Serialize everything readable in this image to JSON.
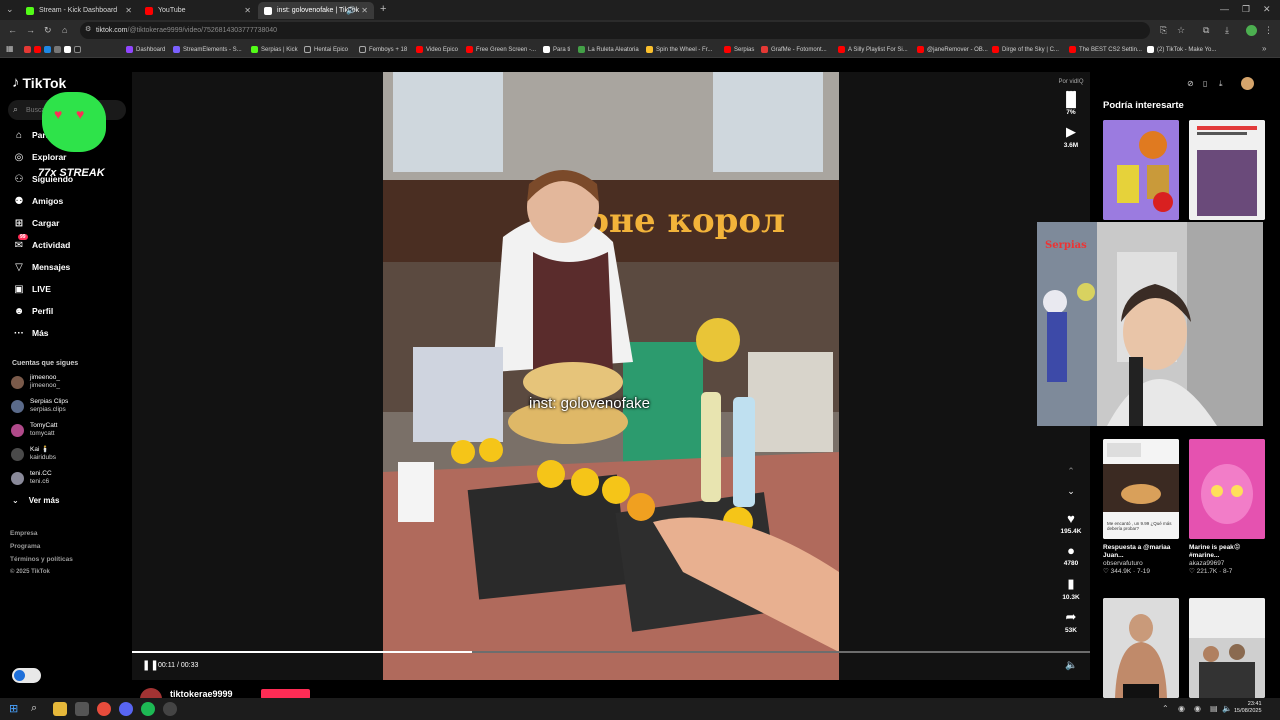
{
  "browser": {
    "tabs": [
      {
        "label": "Stream - Kick Dashboard",
        "color": "#53fc18"
      },
      {
        "label": "YouTube",
        "color": "#ff0000"
      },
      {
        "label": "inst: golovenofake | TikTok",
        "color": "#ffffff"
      }
    ],
    "url_host": "tiktok.com",
    "url_path": "/@tiktokerae9999/video/7526814303777738040",
    "bookmarks": [
      "Dashboard",
      "StreamElements - S...",
      "Serpias | Kick",
      "Hentai Epico",
      "Femboys + 18",
      "Video Epico",
      "Free Green Screen -...",
      "Para ti",
      "La Ruleta Aleatoria",
      "Spin the Wheel - Fr...",
      "Serpias",
      "GrafMe - Fotomont...",
      "A Silly Playlist For Si...",
      "@janeRemover - OB...",
      "Dirge of the Sky | C...",
      "The BEST CS2 Settin...",
      "(2) TikTok - Make Yo..."
    ]
  },
  "sidebar": {
    "logo": "TikTok",
    "search_placeholder": "Buscar",
    "nav": [
      {
        "label": "Para ti",
        "icon": "home-icon"
      },
      {
        "label": "Explorar",
        "icon": "compass-icon"
      },
      {
        "label": "Siguiendo",
        "icon": "following-icon"
      },
      {
        "label": "Amigos",
        "icon": "friends-icon"
      },
      {
        "label": "Cargar",
        "icon": "upload-icon"
      },
      {
        "label": "Actividad",
        "icon": "activity-icon",
        "badge": "99"
      },
      {
        "label": "Mensajes",
        "icon": "messages-icon"
      },
      {
        "label": "LIVE",
        "icon": "live-icon"
      },
      {
        "label": "Perfil",
        "icon": "profile-icon"
      },
      {
        "label": "Más",
        "icon": "more-icon"
      }
    ],
    "following_title": "Cuentas que sigues",
    "following": [
      {
        "name": "jimeenoo_",
        "handle": "jimeenoo_",
        "color": "#7a5a4a"
      },
      {
        "name": "Serpias Clips",
        "handle": "serpias.clips",
        "color": "#5a6a8a"
      },
      {
        "name": "TomyCatt",
        "handle": "tomycatt",
        "color": "#b04a8a"
      },
      {
        "name": "Kai 🕯️",
        "handle": "kairidubs",
        "color": "#4a4a4a"
      },
      {
        "name": "teni.CC",
        "handle": "teni.c6",
        "color": "#8a8a9a"
      }
    ],
    "see_more": "Ver más",
    "footer": [
      "Empresa",
      "Programa",
      "Términos y políticas",
      "© 2025 TikTok"
    ],
    "streak": "77x STREAK"
  },
  "player": {
    "caption": "inst: golovenofake",
    "time": "00:11 / 00:33",
    "progress": 0.355,
    "pause_icon": "pause-icon",
    "volume_icon": "volume-icon"
  },
  "actions": {
    "vidiq_label": "Por vidIQ",
    "score": "7%",
    "views": "3.6M",
    "likes": "195.4K",
    "comments": "4780",
    "saves": "10.3K",
    "shares": "53K"
  },
  "recommended": {
    "title": "Podría interesarte",
    "items": [
      {
        "title": "Respuesta a @mariaa Juan...",
        "author": "observafuturo",
        "stats": "♡ 344.9K · 7-19"
      },
      {
        "title": "Marine is peak😡 #marine...",
        "author": "akaza99697",
        "stats": "♡ 221.7K · 8-7"
      }
    ],
    "thumb_texts": {
      "t1": "inst: golovenofake",
      "t2": "Me encantó , un 9.99 ¿Qué más debería probar?"
    }
  },
  "webcam": {
    "label": "Serpias"
  },
  "below": {
    "username": "tiktokerae9999"
  },
  "taskbar": {
    "time": "23:41",
    "date": "15/08/2025"
  }
}
